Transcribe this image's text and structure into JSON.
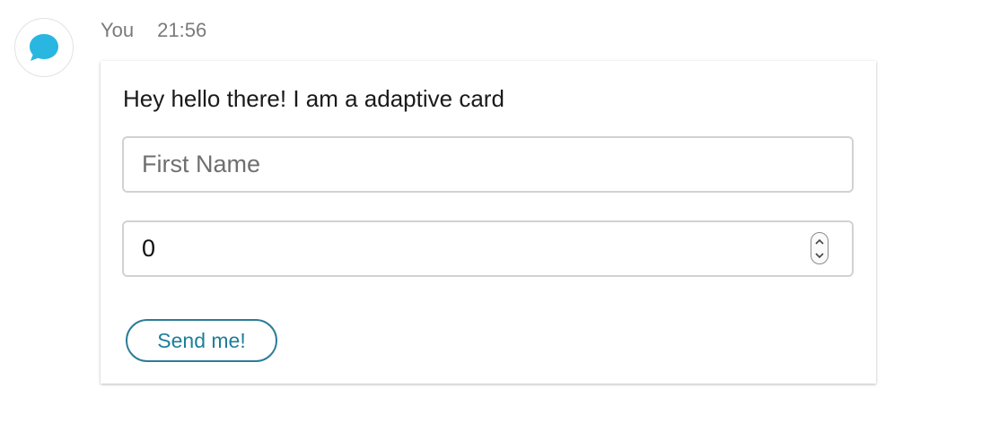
{
  "message": {
    "sender": "You",
    "time": "21:56",
    "avatar_icon": "chat-bubble-icon",
    "avatar_color": "#29b6e0"
  },
  "card": {
    "text": "Hey hello there! I am a adaptive card",
    "name_input": {
      "placeholder": "First Name",
      "value": ""
    },
    "number_input": {
      "value": "0",
      "stepper_icon": "up-down-chevron-icon"
    },
    "submit_label": "Send me!",
    "accent_color": "#1d7e9a"
  }
}
